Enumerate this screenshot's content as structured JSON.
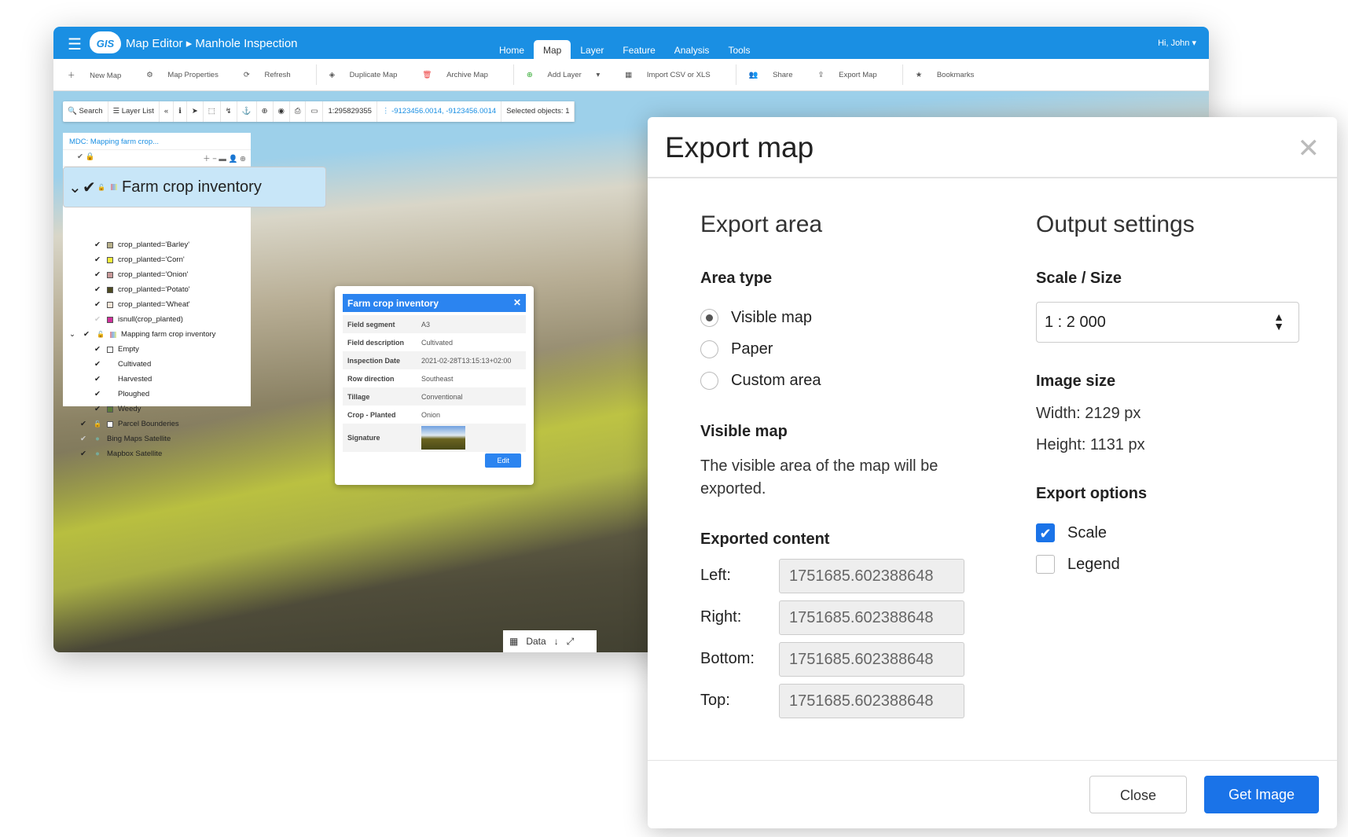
{
  "header": {
    "title": "Map Editor",
    "subtitle": "Manhole Inspection",
    "logo": "GIS",
    "tabs": [
      "Home",
      "Map",
      "Layer",
      "Feature",
      "Analysis",
      "Tools"
    ],
    "active_tab": "Map",
    "user": "Hi, John"
  },
  "toolbar": [
    "New Map",
    "Map Properties",
    "Refresh",
    "Duplicate Map",
    "Archive Map",
    "Add Layer",
    "Import CSV or XLS",
    "Share",
    "Export Map",
    "Bookmarks"
  ],
  "map_toolbar": {
    "search": "Search",
    "layer_list": "Layer List",
    "scale": "1:295829355",
    "coords": "-9123456.0014, -9123456.0014",
    "selected": "Selected objects: 1"
  },
  "layer_panel": {
    "title": "MDC: Mapping farm crop...",
    "layers": [
      {
        "label": "Farm crop inventory",
        "level": 0,
        "checked": true,
        "expand": true,
        "color": ""
      },
      {
        "label": "crop_planted='Barley'",
        "level": 1,
        "checked": true,
        "color": "#b8b08a"
      },
      {
        "label": "crop_planted='Corn'",
        "level": 1,
        "checked": true,
        "color": "#f5ef3a"
      },
      {
        "label": "crop_planted='Onion'",
        "level": 1,
        "checked": true,
        "color": "#c99a9a"
      },
      {
        "label": "crop_planted='Potato'",
        "level": 1,
        "checked": true,
        "color": "#4d4a22"
      },
      {
        "label": "crop_planted='Wheat'",
        "level": 1,
        "checked": true,
        "color": "#f5e6d8"
      },
      {
        "label": "isnull(crop_planted)",
        "level": 1,
        "checked": false,
        "color": "#d0309c"
      },
      {
        "label": "Mapping farm crop inventory",
        "level": 0,
        "checked": true,
        "expand": true,
        "color": ""
      },
      {
        "label": "Empty",
        "level": 1,
        "checked": true,
        "color": "#ffffff"
      },
      {
        "label": "Cultivated",
        "level": 1,
        "checked": true,
        "color": ""
      },
      {
        "label": "Harvested",
        "level": 1,
        "checked": true,
        "color": ""
      },
      {
        "label": "Ploughed",
        "level": 1,
        "checked": true,
        "color": ""
      },
      {
        "label": "Weedy",
        "level": 1,
        "checked": true,
        "color": "#5a7a3a"
      },
      {
        "label": "Parcel Bounderies",
        "level": 0,
        "checked": true,
        "color": "#ffffff"
      },
      {
        "label": "Bing Maps Satellite",
        "level": -1,
        "checked": false,
        "color": ""
      },
      {
        "label": "Mapbox Satellite",
        "level": -1,
        "checked": true,
        "color": ""
      }
    ]
  },
  "popup": {
    "title": "Farm crop inventory",
    "rows": [
      [
        "Field segment",
        "A3"
      ],
      [
        "Field description",
        "Cultivated"
      ],
      [
        "Inspection Date",
        "2021-02-28T13:15:13+02:00"
      ],
      [
        "Row direction",
        "Southeast"
      ],
      [
        "Tillage",
        "Conventional"
      ],
      [
        "Crop - Planted",
        "Onion"
      ],
      [
        "Signature",
        ""
      ]
    ],
    "edit": "Edit"
  },
  "data_bar": {
    "label": "Data"
  },
  "dialog": {
    "title": "Export map",
    "export_area": "Export area",
    "area_type": "Area type",
    "options": [
      "Visible map",
      "Paper",
      "Custom area"
    ],
    "selected": "Visible map",
    "visible_map_heading": "Visible map",
    "visible_map_desc": "The visible area of the map will be exported.",
    "exported_content": "Exported content",
    "fields": [
      [
        "Left:",
        "1751685.602388648"
      ],
      [
        "Right:",
        "1751685.602388648"
      ],
      [
        "Bottom:",
        "1751685.602388648"
      ],
      [
        "Top:",
        "1751685.602388648"
      ]
    ],
    "output_settings": "Output settings",
    "scale_size": "Scale / Size",
    "scale_value": "1 : 2 000",
    "image_size": "Image size",
    "width": "Width:  2129 px",
    "height": "Height:  1131 px",
    "export_options": "Export options",
    "checks": [
      {
        "label": "Scale",
        "checked": true
      },
      {
        "label": "Legend",
        "checked": false
      }
    ],
    "close": "Close",
    "get_image": "Get Image"
  },
  "colors": {
    "brand": "#1a8fe3",
    "primary_button": "#1a73e8"
  }
}
